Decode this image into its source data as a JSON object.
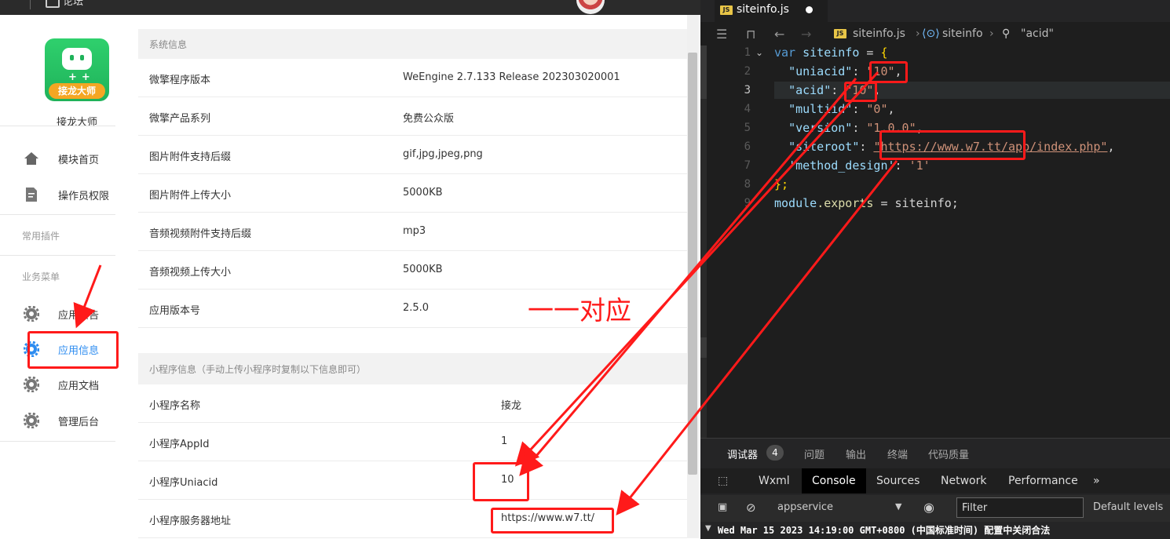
{
  "topbar": {
    "title": "论坛"
  },
  "sidebar": {
    "app_name": "接龙大师",
    "logo_text": "接龙大师",
    "nav_top": [
      {
        "label": "模块首页",
        "icon": "home-icon"
      },
      {
        "label": "操作员权限",
        "icon": "document-icon"
      }
    ],
    "section_plugins": "常用插件",
    "section_business": "业务菜单",
    "nav_business": [
      {
        "label": "应用公告",
        "icon": "gear-icon"
      },
      {
        "label": "应用信息",
        "icon": "gear-icon"
      },
      {
        "label": "应用文档",
        "icon": "gear-icon"
      },
      {
        "label": "管理后台",
        "icon": "gear-icon"
      }
    ]
  },
  "system_info": {
    "header": "系统信息",
    "rows": [
      {
        "key": "微擎程序版本",
        "value": "WeEngine 2.7.133 Release 202303020001"
      },
      {
        "key": "微擎产品系列",
        "value": "免费公众版"
      },
      {
        "key": "图片附件支持后缀",
        "value": "gif,jpg,jpeg,png"
      },
      {
        "key": "图片附件上传大小",
        "value": "5000KB"
      },
      {
        "key": "音频视频附件支持后缀",
        "value": "mp3"
      },
      {
        "key": "音频视频上传大小",
        "value": "5000KB"
      },
      {
        "key": "应用版本号",
        "value": "2.5.0"
      }
    ]
  },
  "miniapp_info": {
    "header": "小程序信息（手动上传小程序时复制以下信息即可）",
    "rows": [
      {
        "key": "小程序名称",
        "value": "接龙"
      },
      {
        "key": "小程序AppId",
        "value": "1"
      },
      {
        "key": "小程序Uniacid",
        "value": "10"
      },
      {
        "key": "小程序服务器地址",
        "value": "https://www.w7.tt/"
      }
    ]
  },
  "annotation": {
    "text": "一一对应",
    "color": "#ff1a1a"
  },
  "editor": {
    "tab_name": "siteinfo.js",
    "breadcrumb": [
      "siteinfo.js",
      "siteinfo",
      "\"acid\""
    ],
    "line_numbers": [
      "1",
      "2",
      "3",
      "4",
      "5",
      "6",
      "7",
      "8",
      "9"
    ],
    "code": {
      "l1_kw": "var",
      "l1_id": "siteinfo",
      "l1_op": " = ",
      "l1_brace": "{",
      "l2_key": "\"uniacid\"",
      "l2_val": "\"10\"",
      "l3_key": "\"acid\"",
      "l3_val": "\"10\"",
      "l4_key": "\"multiid\"",
      "l4_val": "\"0\"",
      "l5_key": "\"version\"",
      "l5_val": "\"1.0.0\"",
      "l6_key": "\"siteroot\"",
      "l6_val": "\"https://www.w7.tt/app/index.php\"",
      "l7_key": "'method_design'",
      "l7_val": "'1'",
      "l8": "};",
      "l9_obj": "module",
      "l9_prop": ".exports",
      "l9_rest": " = siteinfo;"
    }
  },
  "panel": {
    "tabs": [
      "调试器",
      "问题",
      "输出",
      "终端",
      "代码质量"
    ],
    "debugger_count": "4",
    "devtools_tabs": [
      "Wxml",
      "Console",
      "Sources",
      "Network",
      "Performance"
    ],
    "context": "appservice",
    "filter_placeholder": "Filter",
    "levels": "Default levels",
    "log_line": "Wed Mar 15 2023 14:19:00 GMT+0800 (中国标准时间) 配置中关闭合法"
  }
}
